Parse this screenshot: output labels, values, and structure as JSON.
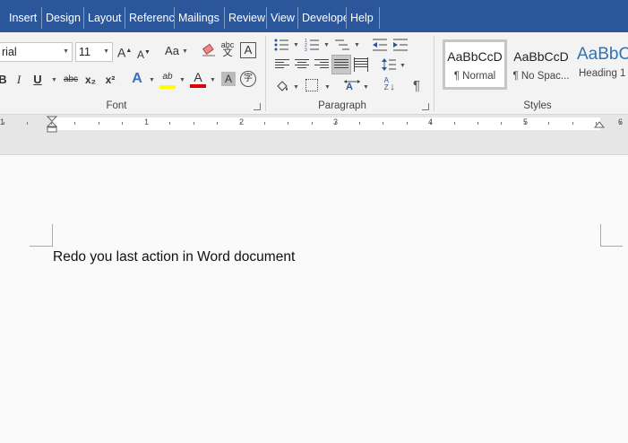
{
  "tabs": [
    "Insert",
    "Design",
    "Layout",
    "Referenc",
    "Mailings",
    "Review",
    "View",
    "Develope",
    "Help"
  ],
  "font": {
    "name": "rial",
    "size": "11",
    "group_label": "Font",
    "bold": "B",
    "underline": "U",
    "strikethrough": "abc",
    "subscript": "x₂",
    "superscript": "x²",
    "grow": "A",
    "shrink": "A",
    "change_case": "Aa",
    "highlight": "ab",
    "font_color": "A",
    "shading": "A",
    "phonetic": "abc",
    "border": "A",
    "text_effects": "A",
    "enclose": "字"
  },
  "paragraph": {
    "group_label": "Paragraph",
    "sort": "A Z",
    "pilcrow": "¶"
  },
  "styles": {
    "group_label": "Styles",
    "items": [
      {
        "sample": "AaBbCcD",
        "name": "¶ Normal"
      },
      {
        "sample": "AaBbCcD",
        "name": "¶ No Spac..."
      },
      {
        "sample": "AaBbC",
        "name": "Heading 1"
      }
    ]
  },
  "ruler": {
    "numbers": [
      "1",
      "1",
      "2",
      "3",
      "4",
      "5",
      "6"
    ]
  },
  "document": {
    "text": "Redo you last action in Word document"
  },
  "colors": {
    "accent": "#2b579a",
    "highlight": "#ffff00",
    "font_red": "#e00000"
  }
}
